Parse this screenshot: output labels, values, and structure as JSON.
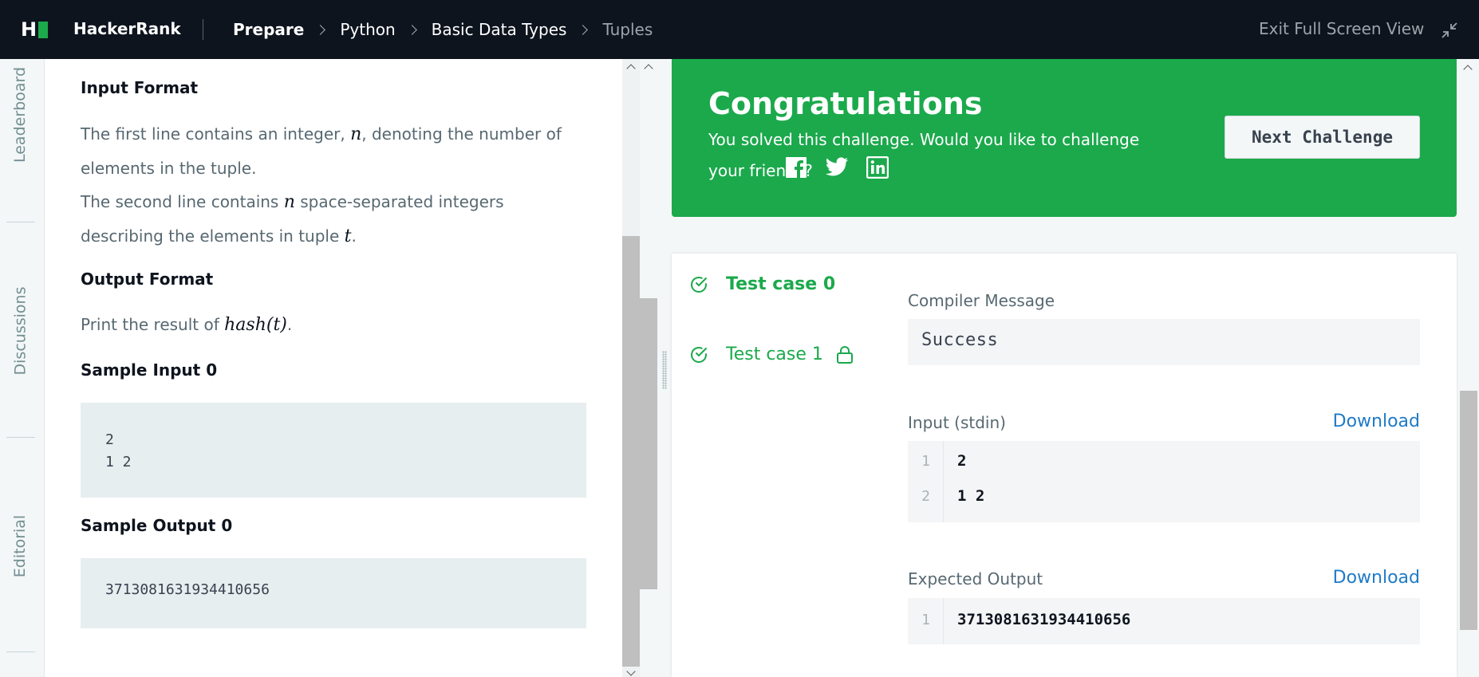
{
  "header": {
    "brand": "HackerRank",
    "breadcrumbs": [
      "Prepare",
      "Python",
      "Basic Data Types",
      "Tuples"
    ],
    "exit_label": "Exit Full Screen View"
  },
  "side_tabs": [
    "Leaderboard",
    "Discussions",
    "Editorial"
  ],
  "problem": {
    "input_format_title": "Input Format",
    "input_line1_a": "The first line contains an integer, ",
    "input_line1_var": "n",
    "input_line1_b": ", denoting the number of elements in the tuple.",
    "input_line2_a": "The second line contains ",
    "input_line2_var": "n",
    "input_line2_b": " space-separated integers describing the elements in tuple ",
    "input_line2_var2": "t",
    "input_line2_c": ".",
    "output_format_title": "Output Format",
    "output_text_a": "Print the result of ",
    "output_text_math": "hash(t)",
    "output_text_b": ".",
    "sample_input_title": "Sample Input 0",
    "sample_input_lines": [
      "2",
      "1 2"
    ],
    "sample_output_title": "Sample Output 0",
    "sample_output": "3713081631934410656"
  },
  "result_banner": {
    "title": "Congratulations",
    "message": "You solved this challenge. Would you like to challenge your friends?",
    "next_button": "Next Challenge",
    "share_icons": [
      "facebook-icon",
      "twitter-icon",
      "linkedin-icon"
    ]
  },
  "test_cases": [
    {
      "label": "Test case 0",
      "status": "passed",
      "locked": false
    },
    {
      "label": "Test case 1",
      "status": "passed",
      "locked": true
    }
  ],
  "details": {
    "compiler_label": "Compiler Message",
    "compiler_message": "Success",
    "input_label": "Input (stdin)",
    "download_label": "Download",
    "input_lines": [
      {
        "n": "1",
        "v": "2"
      },
      {
        "n": "2",
        "v": "1 2"
      }
    ],
    "expected_label": "Expected Output",
    "expected_lines": [
      {
        "n": "1",
        "v": "3713081631934410656"
      }
    ]
  },
  "colors": {
    "accent_green": "#1ba94c",
    "topbar": "#0e141e",
    "link_blue": "#1f7bc7"
  }
}
